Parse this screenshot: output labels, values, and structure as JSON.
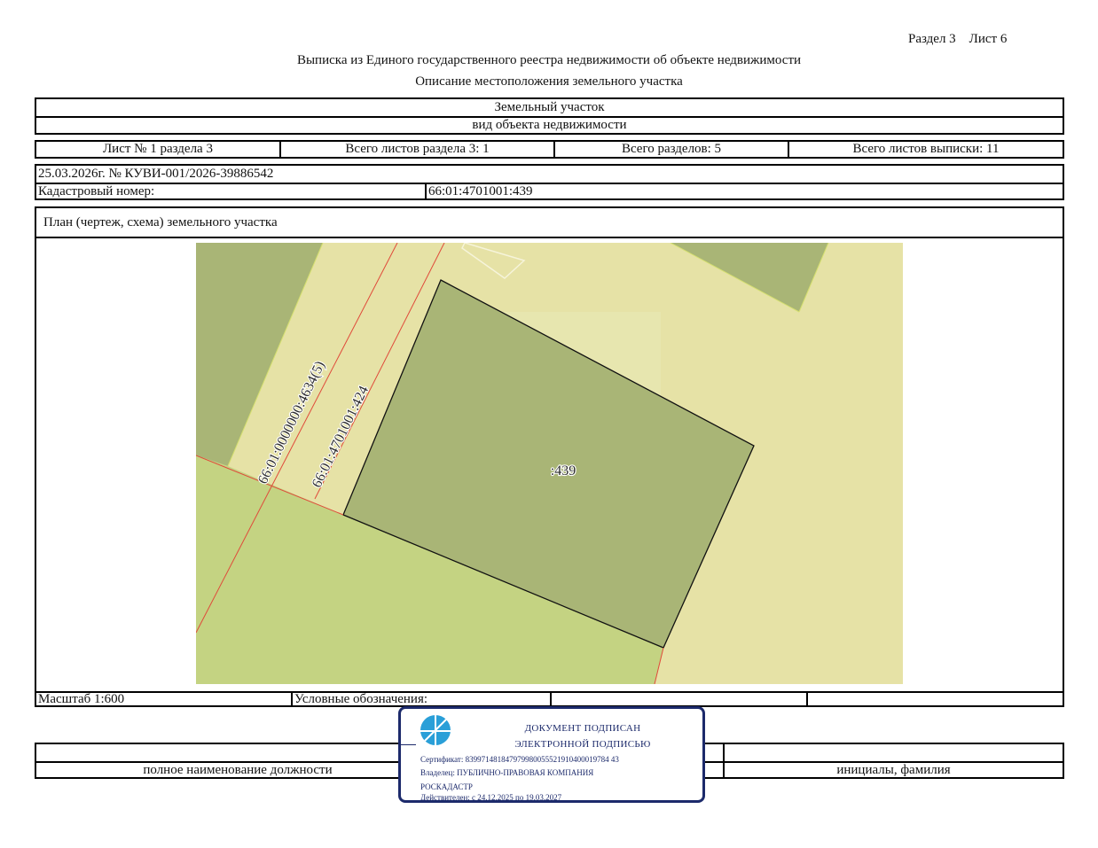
{
  "header": {
    "section_sheet": "Раздел 3    Лист 6",
    "title": "Выписка из Единого государственного реестра недвижимости об объекте недвижимости",
    "subtitle": "Описание местоположения земельного участка"
  },
  "object": {
    "type": "Земельный участок",
    "type_caption": "вид объекта недвижимости"
  },
  "sheets": {
    "sheet_no": "Лист № 1 раздела 3",
    "total_sheets_section": "Всего листов раздела 3: 1",
    "total_sections": "Всего разделов: 5",
    "total_sheets_extract": "Всего листов выписки: 11"
  },
  "doc": {
    "date_number": "25.03.2026г. № КУВИ-001/2026-39886542",
    "cadastral_label": "Кадастровый номер:",
    "cadastral_value": "66:01:4701001:439"
  },
  "plan": {
    "title": "План (чертеж, схема) земельного участка",
    "labels": {
      "parcel": ":439",
      "neighbor_1": "66:01:4701001:424",
      "neighbor_2": "66:01:0000000:4634(5)"
    },
    "colors": {
      "background": "#e6e2a6",
      "dark_green": "#a9b576",
      "light_green": "#c4d382",
      "boundary_red": "#e04a3a",
      "light_strip": "#e8e9b6"
    }
  },
  "legend": {
    "scale": "Масштаб 1:600",
    "legend_label": "Условные обозначения:"
  },
  "signature": {
    "position_caption": "полное наименование должности",
    "name_caption": "инициалы, фамилия"
  },
  "stamp": {
    "line1": "ДОКУМЕНТ ПОДПИСАН",
    "line2": "ЭЛЕКТРОННОЙ ПОДПИСЬЮ",
    "certificate": "Сертификат: 839971481847979980055521910400019784 43",
    "owner": "Владелец: ПУБЛИЧНО-ПРАВОВАЯ КОМПАНИЯ",
    "owner2": "РОСКАДАСТР",
    "valid": "Действителен: с 24.12.2025 по 19.03.2027",
    "logo_icon": "roskadastr-logo-icon"
  }
}
